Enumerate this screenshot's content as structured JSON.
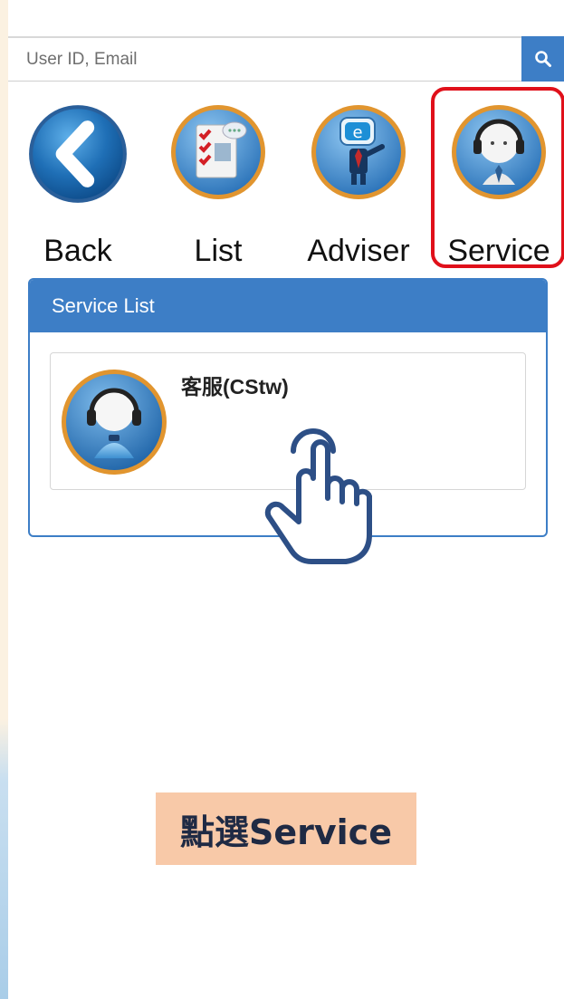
{
  "search": {
    "placeholder": "User ID, Email",
    "button_icon": "search-icon"
  },
  "nav": {
    "items": [
      {
        "label": "Back",
        "icon": "back-arrow-icon"
      },
      {
        "label": "List",
        "icon": "checklist-icon"
      },
      {
        "label": "Adviser",
        "icon": "adviser-robot-icon"
      },
      {
        "label": "Service",
        "icon": "headset-agent-icon",
        "selected": true
      }
    ]
  },
  "service_list": {
    "title": "Service List",
    "items": [
      {
        "name": "客服(CStw)",
        "icon": "headset-agent-icon"
      }
    ]
  },
  "caption": "點選Service",
  "colors": {
    "accent": "#3d7ec6",
    "highlight": "#e0101a",
    "caption_bg": "#f8c9a8",
    "page_bg": "#fbf1e1"
  }
}
